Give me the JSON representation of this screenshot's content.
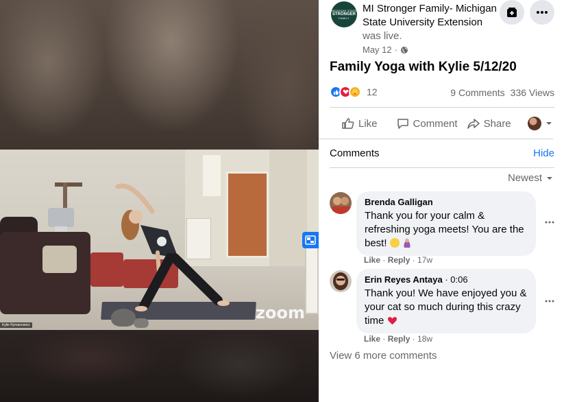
{
  "video": {
    "zoom_label": "zoom",
    "participant_name": "Kylie Rymanowicz"
  },
  "post": {
    "page_name": "MI Stronger Family- Michigan State University Extension",
    "was_live": "was live.",
    "date": "May 12",
    "separator": "·",
    "avatar_small_text": "MICHIGAN STATE",
    "avatar_main_text": "STRONGER",
    "avatar_sub_text": "FAMILY",
    "title": "Family Yoga with Kylie 5/12/20",
    "reaction_count": "12",
    "comments_count": "9 Comments",
    "views_count": "336 Views"
  },
  "actions": {
    "like": "Like",
    "comment": "Comment",
    "share": "Share"
  },
  "comments_section": {
    "heading": "Comments",
    "hide": "Hide",
    "sort": "Newest",
    "view_more": "View 6 more comments",
    "items": [
      {
        "author": "Brenda Galligan",
        "text": "Thank you for your calm & refreshing yoga meets! You are the best!",
        "like": "Like",
        "reply": "Reply",
        "age": "17w"
      },
      {
        "author": "Erin Reyes Antaya",
        "timestamp": "0:06",
        "text": "Thank you! We have enjoyed you & your cat so much during this crazy time",
        "like": "Like",
        "reply": "Reply",
        "age": "18w"
      }
    ]
  },
  "colors": {
    "accent": "#1877f2",
    "text_secondary": "#65676b",
    "bubble_bg": "#f0f2f5",
    "msu_green": "#18453b",
    "heart": "#e41e3f"
  },
  "icons": [
    "bookmark-add-icon",
    "more-icon",
    "globe-icon",
    "like-reaction-icon",
    "love-reaction-icon",
    "care-reaction-icon",
    "thumbs-up-icon",
    "comment-icon",
    "share-icon",
    "chevron-down-icon",
    "picture-in-picture-icon"
  ]
}
